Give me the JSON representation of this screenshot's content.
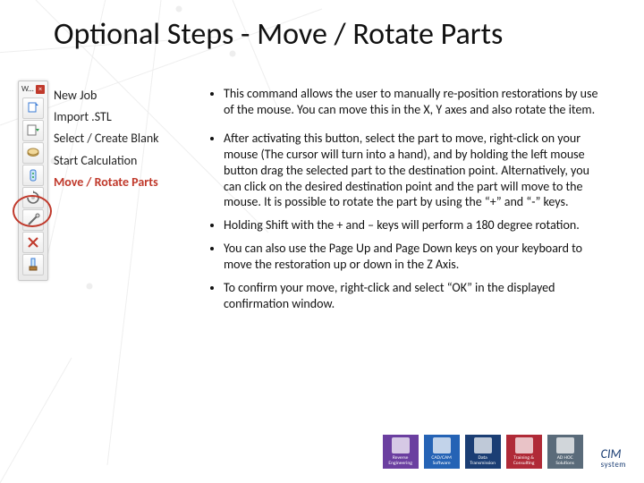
{
  "title": "Optional Steps - Move / Rotate Parts",
  "toolbar": {
    "label": "W...",
    "buttons": [
      {
        "name": "new-job-icon"
      },
      {
        "name": "import-stl-icon"
      },
      {
        "name": "select-blank-icon"
      },
      {
        "name": "start-calc-icon"
      },
      {
        "name": "move-rotate-icon"
      },
      {
        "name": "tool-a-icon"
      },
      {
        "name": "tool-b-icon"
      },
      {
        "name": "tool-c-icon"
      }
    ]
  },
  "nav": {
    "items": [
      {
        "label": "New Job",
        "active": false
      },
      {
        "label": "Import .STL",
        "active": false
      },
      {
        "label": "Select / Create Blank",
        "active": false
      },
      {
        "label": "Start Calculation",
        "active": false
      },
      {
        "label": "Move / Rotate Parts",
        "active": true
      }
    ]
  },
  "bullets": [
    "This command allows the user to manually re-position restorations by use of the mouse. You can move this in the X, Y axes and also rotate the item.",
    "After activating this button, select the part to move, right-click on your mouse (The cursor will turn into a hand), and by holding the left mouse button drag the selected part to the destination point. Alternatively, you can click on the desired destination point and the part will move to the mouse. It is possible to rotate the part by using the “+” and “-” keys.",
    "Holding Shift with the + and – keys will perform a 180 degree rotation.",
    "You can also use the Page Up and Page Down keys on your keyboard to move the restoration up or down in the Z Axis.",
    "To confirm your move, right-click and select “OK” in the displayed confirmation window."
  ],
  "footer": {
    "boxes": [
      {
        "label": "Reverse Engineering",
        "color": "#6b3fa0"
      },
      {
        "label": "CAD/CAM Software",
        "color": "#2563b5"
      },
      {
        "label": "Data Transmission",
        "color": "#1b3e74"
      },
      {
        "label": "Training & Consulting",
        "color": "#b02a37"
      },
      {
        "label": "AD HOC Solutions",
        "color": "#5a6b7a"
      }
    ],
    "brand_main": "CIM",
    "brand_sub": "system"
  }
}
